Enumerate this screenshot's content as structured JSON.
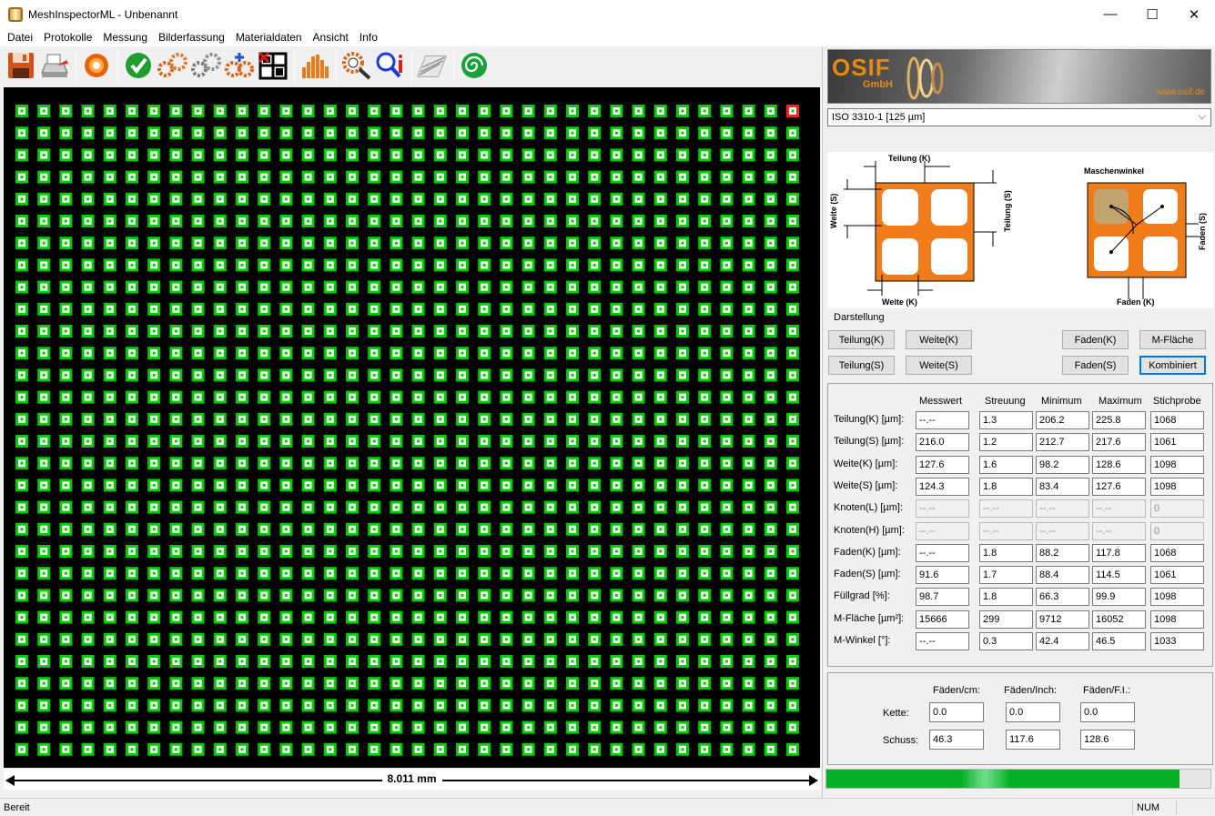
{
  "window": {
    "title": "MeshInspectorML - Unbenannt",
    "controls": [
      "—",
      "☐",
      "✕"
    ]
  },
  "menu": [
    "Datei",
    "Protokolle",
    "Messung",
    "Bilderfassung",
    "Materialdaten",
    "Ansicht",
    "Info"
  ],
  "toolbar": {
    "icons": [
      "save-icon",
      "print-icon",
      "capture-icon",
      "check-icon",
      "gear-orange-icon",
      "gear-gray-icon",
      "gear-multi-icon",
      "grid-mark-icon",
      "histogram-icon",
      "search-settings-icon",
      "zoom-info-icon",
      "mesh-view-icon",
      "spiral-icon"
    ]
  },
  "mesh": {
    "cols": 36,
    "rows": 30,
    "colors": {
      "background": "#000000",
      "cell": "#ffffff",
      "border": "#00cc00",
      "highlight": "#ff2020"
    }
  },
  "scale": {
    "label": "8.011 mm"
  },
  "brand": {
    "name": "OSIF",
    "sub": "GmbH",
    "url": "www.osif.de"
  },
  "standard": {
    "selected": "ISO 3310-1 [125 µm]"
  },
  "diagram_labels": {
    "teilung_k": "Teilung (K)",
    "weite_s": "Weite (S)",
    "teilung_s": "Teilung (S)",
    "weite_k": "Weite (K)",
    "maschenwinkel": "Maschenwinkel",
    "faden_s": "Faden (S)",
    "faden_k": "Faden (K)"
  },
  "darstellung": {
    "label": "Darstellung",
    "buttons": [
      {
        "label": "Teilung(K)"
      },
      {
        "label": "Weite(K)"
      },
      {
        "label": "Faden(K)"
      },
      {
        "label": "M-Fläche"
      },
      {
        "label": "Teilung(S)"
      },
      {
        "label": "Weite(S)"
      },
      {
        "label": "Faden(S)"
      },
      {
        "label": "Kombiniert"
      }
    ]
  },
  "stats": {
    "columns": [
      "Messwert",
      "Streuung",
      "Minimum",
      "Maximum",
      "Stichprobe"
    ],
    "rows": [
      {
        "label": "Teilung(K) [µm]:",
        "values": [
          "--.--",
          "1.3",
          "206.2",
          "225.8",
          "1068"
        ]
      },
      {
        "label": "Teilung(S) [µm]:",
        "values": [
          "216.0",
          "1.2",
          "212.7",
          "217.6",
          "1061"
        ]
      },
      {
        "label": "Weite(K) [µm]:",
        "values": [
          "127.6",
          "1.6",
          "98.2",
          "128.6",
          "1098"
        ]
      },
      {
        "label": "Weite(S) [µm]:",
        "values": [
          "124.3",
          "1.8",
          "83.4",
          "127.6",
          "1098"
        ]
      },
      {
        "label": "Knoten(L) [µm]:",
        "values": [
          "--.--",
          "--.--",
          "--.--",
          "--.--",
          "0"
        ]
      },
      {
        "label": "Knoten(H) [µm]:",
        "values": [
          "--.--",
          "--.--",
          "--.--",
          "--.--",
          "0"
        ]
      },
      {
        "label": "Faden(K) [µm]:",
        "values": [
          "--.--",
          "1.8",
          "88.2",
          "117.8",
          "1068"
        ]
      },
      {
        "label": "Faden(S) [µm]:",
        "values": [
          "91.6",
          "1.7",
          "88.4",
          "114.5",
          "1061"
        ]
      },
      {
        "label": "Füllgrad [%]:",
        "values": [
          "98.7",
          "1.8",
          "66.3",
          "99.9",
          "1098"
        ]
      },
      {
        "label": "M-Fläche [µm²]:",
        "values": [
          "15666",
          "299",
          "9712",
          "16052",
          "1098"
        ]
      },
      {
        "label": "M-Winkel [°]:",
        "values": [
          "--.--",
          "0.3",
          "42.4",
          "46.5",
          "1033"
        ]
      }
    ]
  },
  "threads": {
    "columns": [
      "Fäden/cm:",
      "Fäden/Inch:",
      "Fäden/F.I.:"
    ],
    "rows": [
      {
        "label": "Kette:",
        "values": [
          "0.0",
          "0.0",
          "0.0"
        ]
      },
      {
        "label": "Schuss:",
        "values": [
          "46.3",
          "117.6",
          "128.6"
        ]
      }
    ]
  },
  "progress": {
    "value": 0.92
  },
  "status": {
    "text": "Bereit",
    "num": "NUM"
  }
}
